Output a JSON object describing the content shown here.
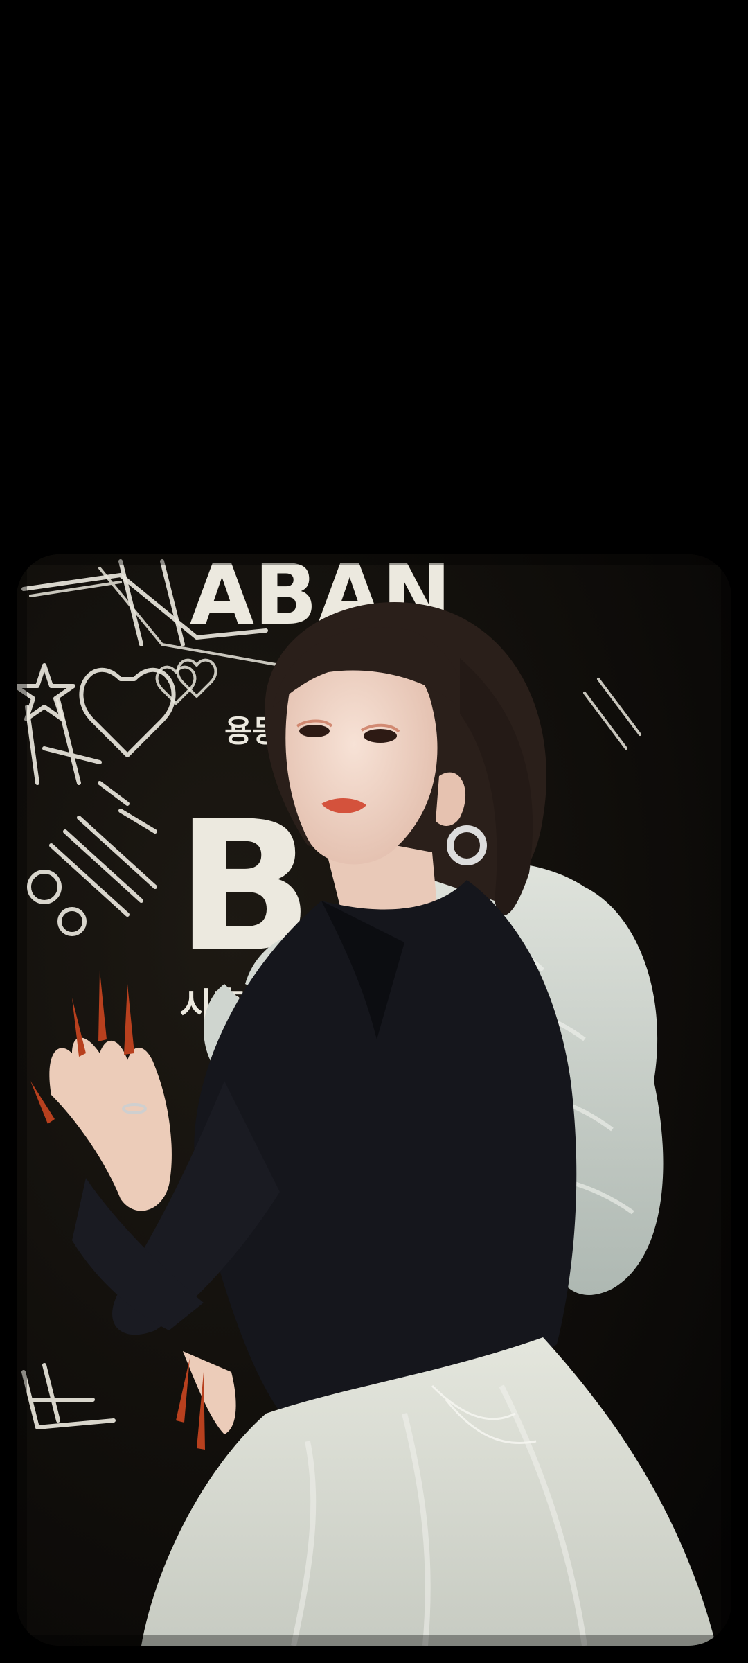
{
  "screen": {
    "background_color": "#000000"
  },
  "photo": {
    "subject": "person-in-black-jacket-and-white-tulle-skirt",
    "wall_text": {
      "top": "ABAN",
      "big_letter": "B",
      "korean_1": "시훈",
      "korean_2": "용동"
    },
    "colors": {
      "wall": "#0b0907",
      "chalk": "#e9e6dc",
      "jacket": "#15161c",
      "tulle": "#c9cfc9",
      "skin": "#f0d3c2",
      "hair": "#2a1f1a",
      "nails": "#b8401e"
    }
  }
}
